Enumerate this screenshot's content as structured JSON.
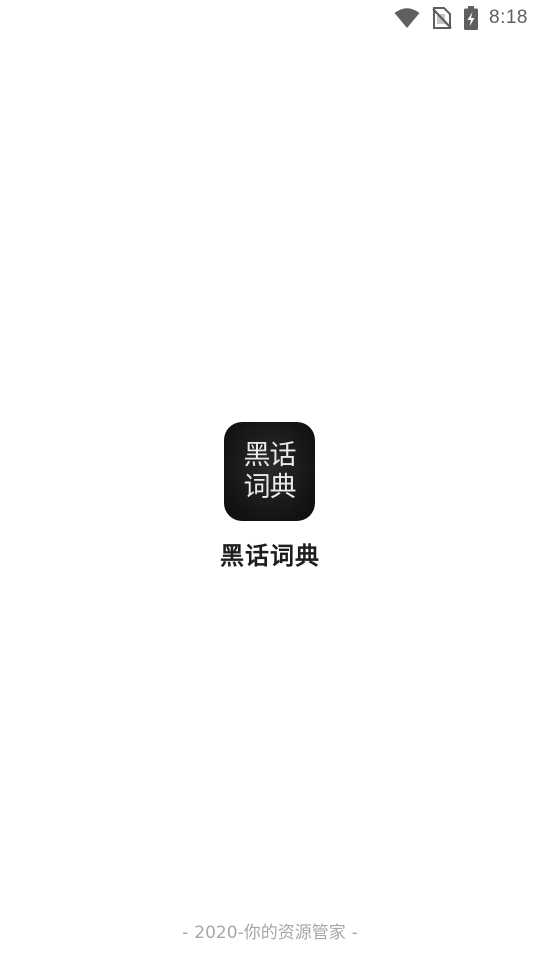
{
  "status_bar": {
    "time": "8:18",
    "icons": [
      "wifi-icon",
      "no-sim-icon",
      "battery-charging-icon"
    ]
  },
  "splash": {
    "icon_line1": "黑话",
    "icon_line2": "词典",
    "app_name": "黑话词典",
    "footer_left": "-",
    "footer_text": "2020-你的资源管家",
    "footer_right": "-"
  },
  "colors": {
    "background": "#ffffff",
    "icon_background": "#141414",
    "icon_text": "#eaeaea",
    "title": "#1e1e1e",
    "footer": "#a7a7a7",
    "status_icons": "#5f5f5f"
  }
}
